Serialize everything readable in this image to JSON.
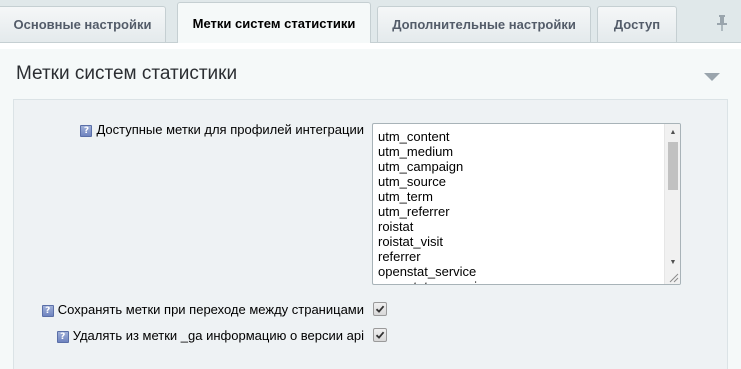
{
  "tabs": [
    {
      "label": "Основные настройки",
      "active": false
    },
    {
      "label": "Метки систем статистики",
      "active": true
    },
    {
      "label": "Дополнительные настройки",
      "active": false
    },
    {
      "label": "Доступ",
      "active": false
    }
  ],
  "section": {
    "title": "Метки систем статистики"
  },
  "form": {
    "help_glyph": "?",
    "tags_label": "Доступные метки для профилей интеграции",
    "tags_options": [
      "utm_content",
      "utm_medium",
      "utm_campaign",
      "utm_source",
      "utm_term",
      "utm_referrer",
      "roistat",
      "roistat_visit",
      "referrer",
      "openstat_service",
      "openstat_campaign"
    ],
    "save_tags_label": "Сохранять метки при переходе между страницами",
    "save_tags_checked": true,
    "strip_ga_label": "Удалять из метки _ga информацию о версии api",
    "strip_ga_checked": true
  },
  "colors": {
    "background": "#e0e8ea",
    "panel": "#f5f9f9",
    "content_box": "#eef2f4",
    "tab_text": "#535c69",
    "help_icon": "#6f84bf"
  },
  "icons": {
    "pin": "pin-icon",
    "collapse": "triangle-down-icon",
    "help": "question-icon",
    "check": "check-icon"
  }
}
